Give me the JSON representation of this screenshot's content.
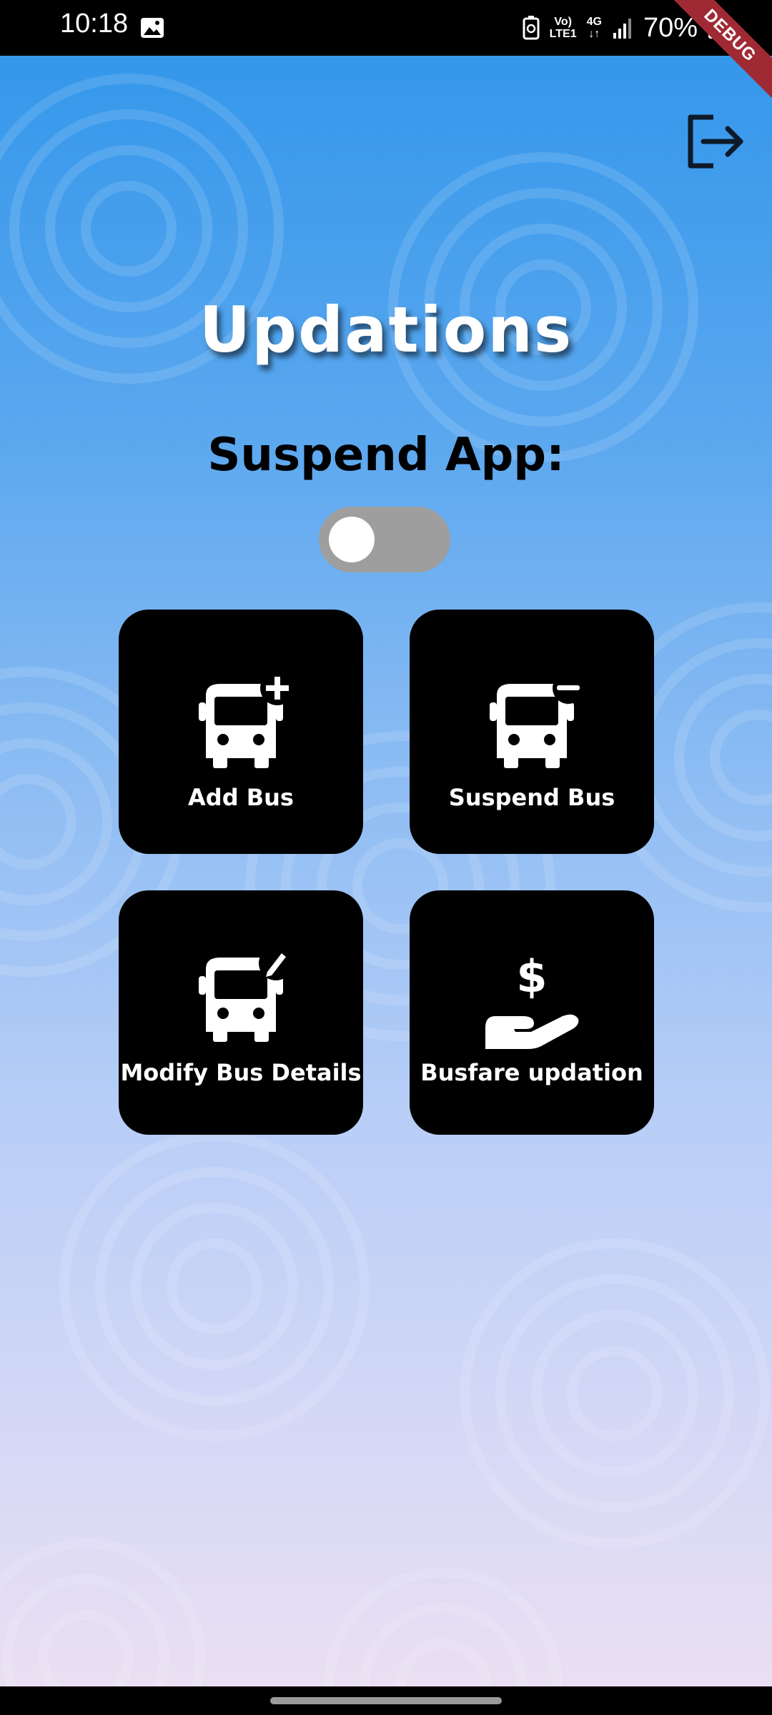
{
  "status_bar": {
    "time": "10:18",
    "network_top": "Vo)",
    "network_bottom": "LTE1",
    "data_top": "4G",
    "battery": "70%",
    "icons": [
      "gallery-icon",
      "battery-saver-icon",
      "signal-icon",
      "battery-icon"
    ]
  },
  "debug_banner": "DEBUG",
  "header": {
    "logout_icon": "logout-icon"
  },
  "page": {
    "title": "Updations",
    "suspend_label": "Suspend App:",
    "suspend_toggle_on": false
  },
  "tiles": [
    {
      "label": "Add Bus",
      "icon": "bus-add-icon"
    },
    {
      "label": "Suspend Bus",
      "icon": "bus-remove-icon"
    },
    {
      "label": "Modify Bus Details",
      "icon": "bus-edit-icon"
    },
    {
      "label": "Busfare updation",
      "icon": "fare-hand-dollar-icon"
    }
  ],
  "colors": {
    "gradient_top": "#2f95ea",
    "gradient_bottom": "#ece0f2",
    "tile_bg": "#000000",
    "toggle_off": "#9e9e9e"
  }
}
